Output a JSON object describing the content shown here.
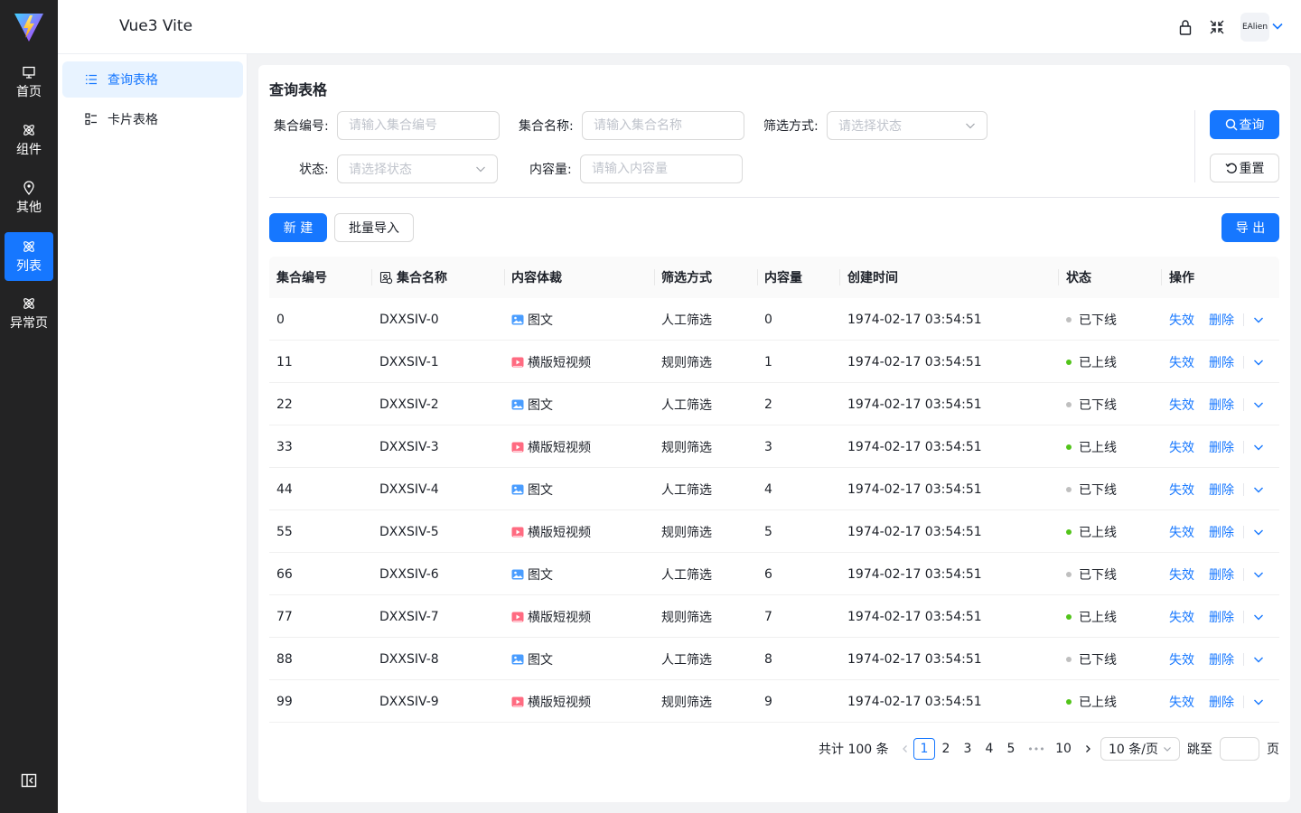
{
  "app": {
    "title": "Vue3 Vite"
  },
  "rail": {
    "items": [
      {
        "label": "首页",
        "icon": "monitor-icon"
      },
      {
        "label": "组件",
        "icon": "atom-icon"
      },
      {
        "label": "其他",
        "icon": "location-icon"
      },
      {
        "label": "列表",
        "icon": "atom-icon",
        "active": true
      },
      {
        "label": "异常页",
        "icon": "atom-icon"
      }
    ]
  },
  "header": {
    "user": "EAlien"
  },
  "submenu": {
    "items": [
      {
        "label": "查询表格",
        "icon": "list-icon",
        "active": true
      },
      {
        "label": "卡片表格",
        "icon": "card-list-icon"
      }
    ]
  },
  "page": {
    "title": "查询表格"
  },
  "filters": {
    "set_no_label": "集合编号:",
    "set_no_placeholder": "请输入集合编号",
    "set_name_label": "集合名称:",
    "set_name_placeholder": "请输入集合名称",
    "filter_label": "筛选方式:",
    "filter_placeholder": "请选择状态",
    "status_label": "状态:",
    "status_placeholder": "请选择状态",
    "volume_label": "内容量:",
    "volume_placeholder": "请输入内容量",
    "search_btn": "查询",
    "reset_btn": "重置"
  },
  "toolbar": {
    "new_btn": "新 建",
    "import_btn": "批量导入",
    "export_btn": "导 出"
  },
  "table": {
    "columns": [
      "集合编号",
      "集合名称",
      "内容体裁",
      "筛选方式",
      "内容量",
      "创建时间",
      "状态",
      "操作"
    ],
    "op_invalid": "失效",
    "op_delete": "删除",
    "rows": [
      {
        "id": "0",
        "name": "DXXSIV-0",
        "genre": "图文",
        "genre_type": "image",
        "filter": "人工筛选",
        "volume": "0",
        "created": "1974-02-17 03:54:51",
        "status": "已下线",
        "online": false
      },
      {
        "id": "11",
        "name": "DXXSIV-1",
        "genre": "横版短视频",
        "genre_type": "video",
        "filter": "规则筛选",
        "volume": "1",
        "created": "1974-02-17 03:54:51",
        "status": "已上线",
        "online": true
      },
      {
        "id": "22",
        "name": "DXXSIV-2",
        "genre": "图文",
        "genre_type": "image",
        "filter": "人工筛选",
        "volume": "2",
        "created": "1974-02-17 03:54:51",
        "status": "已下线",
        "online": false
      },
      {
        "id": "33",
        "name": "DXXSIV-3",
        "genre": "横版短视频",
        "genre_type": "video",
        "filter": "规则筛选",
        "volume": "3",
        "created": "1974-02-17 03:54:51",
        "status": "已上线",
        "online": true
      },
      {
        "id": "44",
        "name": "DXXSIV-4",
        "genre": "图文",
        "genre_type": "image",
        "filter": "人工筛选",
        "volume": "4",
        "created": "1974-02-17 03:54:51",
        "status": "已下线",
        "online": false
      },
      {
        "id": "55",
        "name": "DXXSIV-5",
        "genre": "横版短视频",
        "genre_type": "video",
        "filter": "规则筛选",
        "volume": "5",
        "created": "1974-02-17 03:54:51",
        "status": "已上线",
        "online": true
      },
      {
        "id": "66",
        "name": "DXXSIV-6",
        "genre": "图文",
        "genre_type": "image",
        "filter": "人工筛选",
        "volume": "6",
        "created": "1974-02-17 03:54:51",
        "status": "已下线",
        "online": false
      },
      {
        "id": "77",
        "name": "DXXSIV-7",
        "genre": "横版短视频",
        "genre_type": "video",
        "filter": "规则筛选",
        "volume": "7",
        "created": "1974-02-17 03:54:51",
        "status": "已上线",
        "online": true
      },
      {
        "id": "88",
        "name": "DXXSIV-8",
        "genre": "图文",
        "genre_type": "image",
        "filter": "人工筛选",
        "volume": "8",
        "created": "1974-02-17 03:54:51",
        "status": "已下线",
        "online": false
      },
      {
        "id": "99",
        "name": "DXXSIV-9",
        "genre": "横版短视频",
        "genre_type": "video",
        "filter": "规则筛选",
        "volume": "9",
        "created": "1974-02-17 03:54:51",
        "status": "已上线",
        "online": true
      }
    ]
  },
  "pagination": {
    "total": "共计 100 条",
    "pages": [
      "1",
      "2",
      "3",
      "4",
      "5"
    ],
    "ellipsis": "•••",
    "last": "10",
    "current": "1",
    "page_size": "10 条/页",
    "jump_label": "跳至",
    "page_suffix": "页"
  },
  "colors": {
    "primary": "#1677ff",
    "online": "#52c41a",
    "offline": "#bfbfbf",
    "rail_bg": "#232324"
  }
}
